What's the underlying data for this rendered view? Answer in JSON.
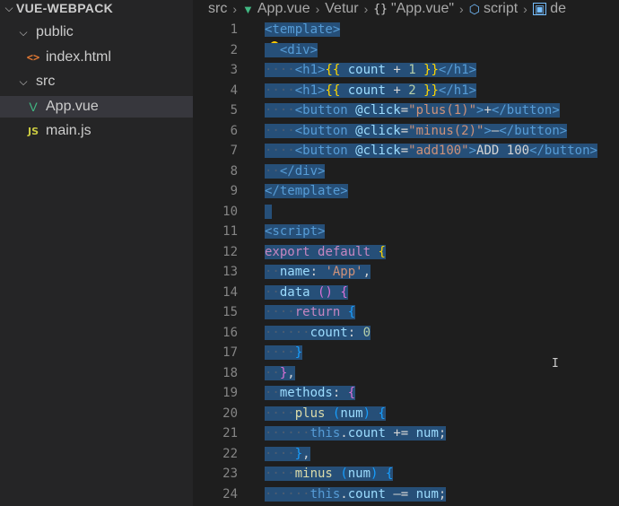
{
  "explorer": {
    "root": "VUE-WEBPACK",
    "items": [
      {
        "label": "public",
        "type": "folder",
        "depth": 1
      },
      {
        "label": "index.html",
        "type": "html",
        "depth": 2,
        "icon": "<>"
      },
      {
        "label": "src",
        "type": "folder",
        "depth": 1
      },
      {
        "label": "App.vue",
        "type": "vue",
        "depth": 2,
        "icon": "V"
      },
      {
        "label": "main.js",
        "type": "js",
        "depth": 2,
        "icon": "JS"
      }
    ]
  },
  "breadcrumb": {
    "src": "src",
    "file": "App.vue",
    "ext": "Vetur",
    "component": "\"App.vue\"",
    "component_icon": "{}",
    "section": "script",
    "trailing": "de"
  },
  "editor": {
    "line_numbers": [
      "1",
      "2",
      "3",
      "4",
      "5",
      "6",
      "7",
      "8",
      "9",
      "10",
      "11",
      "12",
      "13",
      "14",
      "15",
      "16",
      "17",
      "18",
      "19",
      "20",
      "21",
      "22",
      "23",
      "24"
    ],
    "lines": [
      [
        [
          "tag",
          "<template>"
        ]
      ],
      [
        [
          "plain",
          "  "
        ],
        [
          "tag",
          "<div>"
        ]
      ],
      [
        [
          "ws",
          "····"
        ],
        [
          "tag",
          "<h1>"
        ],
        [
          "br1",
          "{{"
        ],
        [
          "plain",
          " "
        ],
        [
          "prop",
          "count"
        ],
        [
          "plain",
          " + "
        ],
        [
          "num",
          "1"
        ],
        [
          "plain",
          " "
        ],
        [
          "br1",
          "}}"
        ],
        [
          "tag",
          "</h1>"
        ]
      ],
      [
        [
          "ws",
          "····"
        ],
        [
          "tag",
          "<h1>"
        ],
        [
          "br1",
          "{{"
        ],
        [
          "plain",
          " "
        ],
        [
          "prop",
          "count"
        ],
        [
          "plain",
          " + "
        ],
        [
          "num",
          "2"
        ],
        [
          "plain",
          " "
        ],
        [
          "br1",
          "}}"
        ],
        [
          "tag",
          "</h1>"
        ]
      ],
      [
        [
          "ws",
          "····"
        ],
        [
          "tag",
          "<button "
        ],
        [
          "attr",
          "@click"
        ],
        [
          "plain",
          "="
        ],
        [
          "str",
          "\"plus(1)\""
        ],
        [
          "tag",
          ">"
        ],
        [
          "plain",
          "+"
        ],
        [
          "tag",
          "</button>"
        ]
      ],
      [
        [
          "ws",
          "····"
        ],
        [
          "tag",
          "<button "
        ],
        [
          "attr",
          "@click"
        ],
        [
          "plain",
          "="
        ],
        [
          "str",
          "\"minus(2)\""
        ],
        [
          "tag",
          ">"
        ],
        [
          "plain",
          "—"
        ],
        [
          "tag",
          "</button>"
        ]
      ],
      [
        [
          "ws",
          "····"
        ],
        [
          "tag",
          "<button "
        ],
        [
          "attr",
          "@click"
        ],
        [
          "plain",
          "="
        ],
        [
          "str",
          "\"add100\""
        ],
        [
          "tag",
          ">"
        ],
        [
          "plain",
          "ADD 100"
        ],
        [
          "tag",
          "</button>"
        ]
      ],
      [
        [
          "ws",
          "··"
        ],
        [
          "tag",
          "</div>"
        ]
      ],
      [
        [
          "tag",
          "</template>"
        ]
      ],
      [
        [
          "plain",
          ""
        ]
      ],
      [
        [
          "tag",
          "<script>"
        ]
      ],
      [
        [
          "kw",
          "export"
        ],
        [
          "plain",
          " "
        ],
        [
          "kw",
          "default"
        ],
        [
          "plain",
          " "
        ],
        [
          "br1",
          "{"
        ]
      ],
      [
        [
          "ws",
          "··"
        ],
        [
          "prop",
          "name"
        ],
        [
          "plain",
          ": "
        ],
        [
          "str",
          "'App'"
        ],
        [
          "plain",
          ","
        ]
      ],
      [
        [
          "ws",
          "··"
        ],
        [
          "prop",
          "data"
        ],
        [
          "plain",
          " "
        ],
        [
          "br2",
          "()"
        ],
        [
          "plain",
          " "
        ],
        [
          "br2",
          "{"
        ]
      ],
      [
        [
          "ws",
          "····"
        ],
        [
          "kw",
          "return"
        ],
        [
          "plain",
          " "
        ],
        [
          "br3",
          "{"
        ]
      ],
      [
        [
          "ws",
          "······"
        ],
        [
          "prop",
          "count"
        ],
        [
          "plain",
          ": "
        ],
        [
          "num",
          "0"
        ]
      ],
      [
        [
          "ws",
          "····"
        ],
        [
          "br3",
          "}"
        ]
      ],
      [
        [
          "ws",
          "··"
        ],
        [
          "br2",
          "}"
        ],
        [
          "plain",
          ","
        ]
      ],
      [
        [
          "ws",
          "··"
        ],
        [
          "prop",
          "methods"
        ],
        [
          "plain",
          ": "
        ],
        [
          "br2",
          "{"
        ]
      ],
      [
        [
          "ws",
          "····"
        ],
        [
          "fn",
          "plus"
        ],
        [
          "plain",
          " "
        ],
        [
          "br3",
          "("
        ],
        [
          "prop",
          "num"
        ],
        [
          "br3",
          ")"
        ],
        [
          "plain",
          " "
        ],
        [
          "br3",
          "{"
        ]
      ],
      [
        [
          "ws",
          "······"
        ],
        [
          "kw2",
          "this"
        ],
        [
          "plain",
          "."
        ],
        [
          "prop",
          "count"
        ],
        [
          "plain",
          " += "
        ],
        [
          "prop",
          "num"
        ],
        [
          "plain",
          ";"
        ]
      ],
      [
        [
          "ws",
          "····"
        ],
        [
          "br3",
          "}"
        ],
        [
          "plain",
          ","
        ]
      ],
      [
        [
          "ws",
          "····"
        ],
        [
          "fn",
          "minus"
        ],
        [
          "plain",
          " "
        ],
        [
          "br3",
          "("
        ],
        [
          "prop",
          "num"
        ],
        [
          "br3",
          ")"
        ],
        [
          "plain",
          " "
        ],
        [
          "br3",
          "{"
        ]
      ],
      [
        [
          "ws",
          "······"
        ],
        [
          "kw2",
          "this"
        ],
        [
          "plain",
          "."
        ],
        [
          "prop",
          "count"
        ],
        [
          "plain",
          " —= "
        ],
        [
          "prop",
          "num"
        ],
        [
          "plain",
          ";"
        ]
      ]
    ]
  },
  "colors": {
    "selection": "#264f78",
    "sidebar_bg": "#252526",
    "editor_bg": "#1e1e1e",
    "selected_file_bg": "#37373d"
  }
}
